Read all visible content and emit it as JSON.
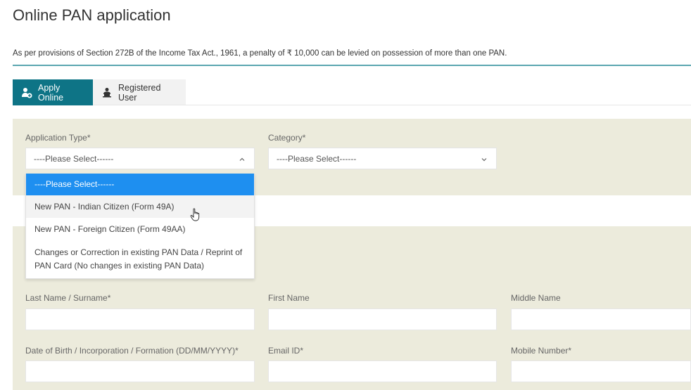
{
  "page": {
    "title": "Online PAN application",
    "notice": "As per provisions of Section 272B of the Income Tax Act., 1961, a penalty of ₹ 10,000 can be levied on possession of more than one PAN."
  },
  "tabs": [
    {
      "label": "Apply Online",
      "icon": "user-plus-icon",
      "active": true
    },
    {
      "label": "Registered User",
      "icon": "user-laptop-icon",
      "active": false
    }
  ],
  "form": {
    "application_type": {
      "label": "Application Type*",
      "value": "----Please Select------",
      "expanded": true,
      "options": [
        "----Please Select------",
        "New PAN - Indian Citizen (Form 49A)",
        "New PAN - Foreign Citizen (Form 49AA)",
        "Changes or Correction in existing PAN Data / Reprint of PAN Card (No changes in existing PAN Data)"
      ],
      "selected_index": 0,
      "hover_index": 1
    },
    "category": {
      "label": "Category*",
      "value": "----Please Select------"
    },
    "last_name": {
      "label": "Last Name / Surname*",
      "value": ""
    },
    "first_name": {
      "label": "First Name",
      "value": ""
    },
    "middle_name": {
      "label": "Middle Name",
      "value": ""
    },
    "dob": {
      "label": "Date of Birth / Incorporation / Formation (DD/MM/YYYY)*",
      "value": ""
    },
    "email": {
      "label": "Email ID*",
      "value": ""
    },
    "mobile": {
      "label": "Mobile Number*",
      "value": ""
    }
  },
  "colors": {
    "accent": "#0e7486",
    "panel_bg": "#ecebdc",
    "dropdown_selected": "#1e8ff0",
    "rule": "#5aa6b0"
  }
}
